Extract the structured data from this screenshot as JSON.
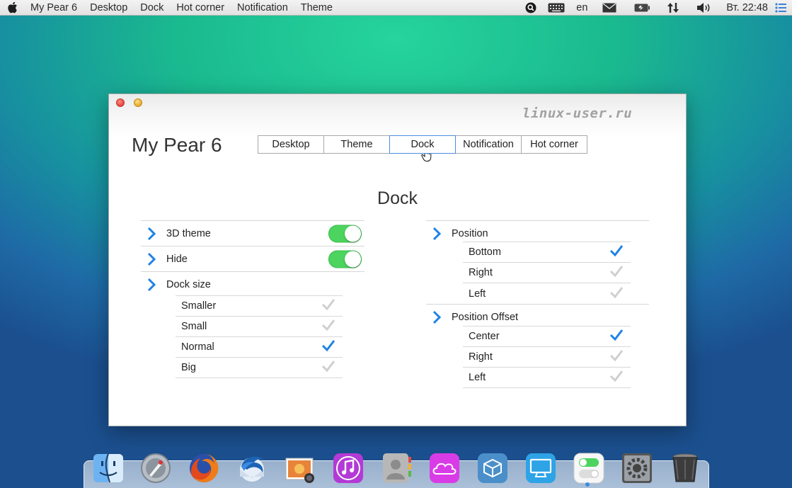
{
  "menubar": {
    "apple_icon": "apple-icon",
    "items": [
      "My Pear 6",
      "Desktop",
      "Dock",
      "Hot corner",
      "Notification",
      "Theme"
    ],
    "keyboard_layout": "en",
    "clock": "Вт. 22:48",
    "tray_icons": [
      "search-icon",
      "keyboard-icon",
      "mail-icon",
      "battery-icon",
      "network-icon",
      "volume-icon",
      "list-icon"
    ]
  },
  "window": {
    "watermark": "linux-user.ru",
    "app_title": "My Pear 6",
    "tabs": [
      {
        "label": "Desktop",
        "active": false
      },
      {
        "label": "Theme",
        "active": false
      },
      {
        "label": "Dock",
        "active": true
      },
      {
        "label": "Notification",
        "active": false
      },
      {
        "label": "Hot corner",
        "active": false
      }
    ],
    "section_title": "Dock",
    "left": {
      "toggles": [
        {
          "label": "3D theme",
          "on": true
        },
        {
          "label": "Hide",
          "on": true
        }
      ],
      "dock_size": {
        "label": "Dock size",
        "options": [
          {
            "label": "Smaller",
            "selected": false
          },
          {
            "label": "Small",
            "selected": false
          },
          {
            "label": "Normal",
            "selected": true
          },
          {
            "label": "Big",
            "selected": false
          }
        ]
      }
    },
    "right": {
      "position": {
        "label": "Position",
        "options": [
          {
            "label": "Bottom",
            "selected": true
          },
          {
            "label": "Right",
            "selected": false
          },
          {
            "label": "Left",
            "selected": false
          }
        ]
      },
      "position_offset": {
        "label": "Position Offset",
        "options": [
          {
            "label": "Center",
            "selected": true
          },
          {
            "label": "Right",
            "selected": false
          },
          {
            "label": "Left",
            "selected": false
          }
        ]
      }
    }
  },
  "dock": {
    "apps": [
      "finder-icon",
      "launchpad-icon",
      "firefox-icon",
      "thunderbird-icon",
      "photos-icon",
      "itunes-icon",
      "contacts-icon",
      "icloud-icon",
      "cydia-icon",
      "display-icon",
      "settings-toggle-icon",
      "system-preferences-icon",
      "trash-icon"
    ]
  },
  "colors": {
    "accent_blue": "#1e82e6",
    "toggle_green": "#4cd45e",
    "check_inactive": "#cfcfcf"
  }
}
